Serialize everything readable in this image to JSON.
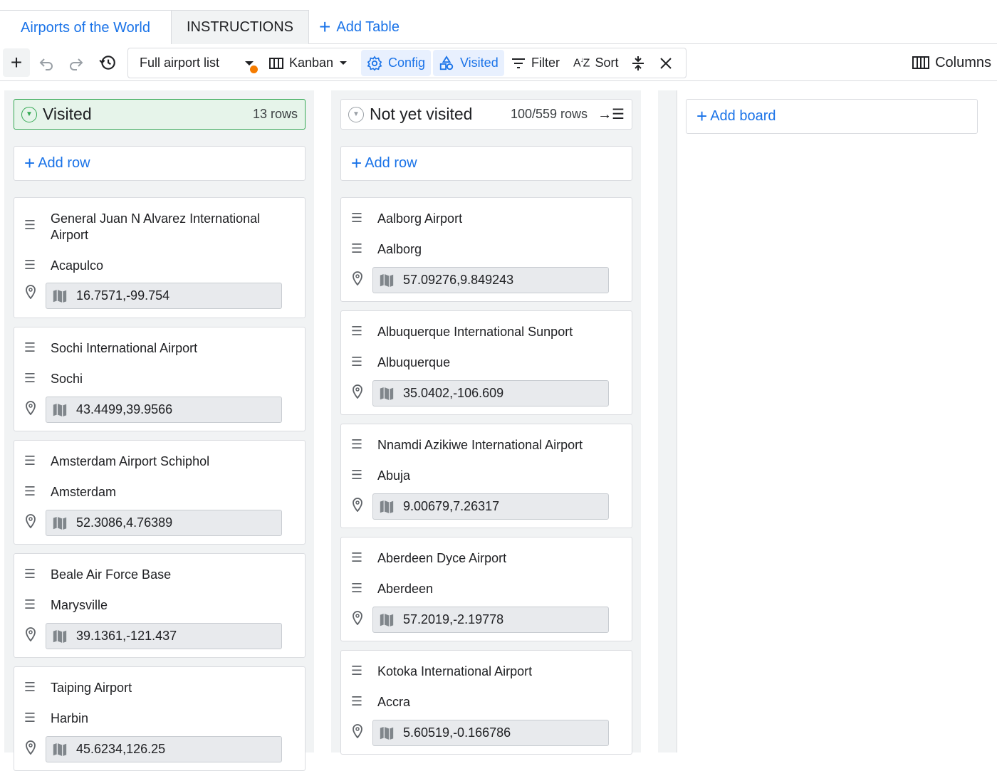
{
  "tabs": {
    "active": "Airports of the World",
    "inactive": "INSTRUCTIONS",
    "add_table": "Add Table"
  },
  "toolbar": {
    "view_list": "Full airport list",
    "layout": "Kanban",
    "config": "Config",
    "visited": "Visited",
    "filter": "Filter",
    "sort": "Sort",
    "columns": "Columns",
    "accent_color": "#1a73e8",
    "indicator_color": "#f57c00"
  },
  "boards": {
    "visited": {
      "title": "Visited",
      "count": "13 rows",
      "add_row": "Add row",
      "cards": [
        {
          "name": "General Juan N Alvarez International Airport",
          "city": "Acapulco",
          "latlng": "16.7571,-99.754"
        },
        {
          "name": "Sochi International Airport",
          "city": "Sochi",
          "latlng": "43.4499,39.9566"
        },
        {
          "name": "Amsterdam Airport Schiphol",
          "city": "Amsterdam",
          "latlng": "52.3086,4.76389"
        },
        {
          "name": "Beale Air Force Base",
          "city": "Marysville",
          "latlng": "39.1361,-121.437"
        },
        {
          "name": "Taiping Airport",
          "city": "Harbin",
          "latlng": "45.6234,126.25"
        }
      ]
    },
    "not_visited": {
      "title": "Not yet visited",
      "count": "100/559 rows",
      "add_row": "Add row",
      "cards": [
        {
          "name": "Aalborg Airport",
          "city": "Aalborg",
          "latlng": "57.09276,9.849243"
        },
        {
          "name": "Albuquerque International Sunport",
          "city": "Albuquerque",
          "latlng": "35.0402,-106.609"
        },
        {
          "name": "Nnamdi Azikiwe International Airport",
          "city": "Abuja",
          "latlng": "9.00679,7.26317"
        },
        {
          "name": "Aberdeen Dyce Airport",
          "city": "Aberdeen",
          "latlng": "57.2019,-2.19778"
        },
        {
          "name": "Kotoka International Airport",
          "city": "Accra",
          "latlng": "5.60519,-0.166786"
        }
      ]
    },
    "add_board": "Add board"
  }
}
